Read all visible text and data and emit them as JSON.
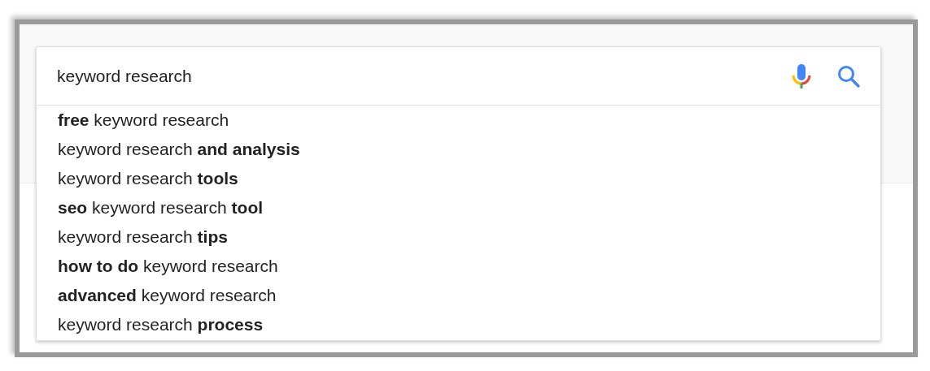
{
  "search": {
    "value": "keyword research"
  },
  "suggestions": [
    {
      "text": "**free** keyword research"
    },
    {
      "text": "keyword research **and analysis**"
    },
    {
      "text": "keyword research **tools**"
    },
    {
      "text": "**seo** keyword research **tool**"
    },
    {
      "text": "keyword research **tips**"
    },
    {
      "text": "**how to do** keyword research"
    },
    {
      "text": "**advanced** keyword research"
    },
    {
      "text": "keyword research **process**"
    }
  ]
}
